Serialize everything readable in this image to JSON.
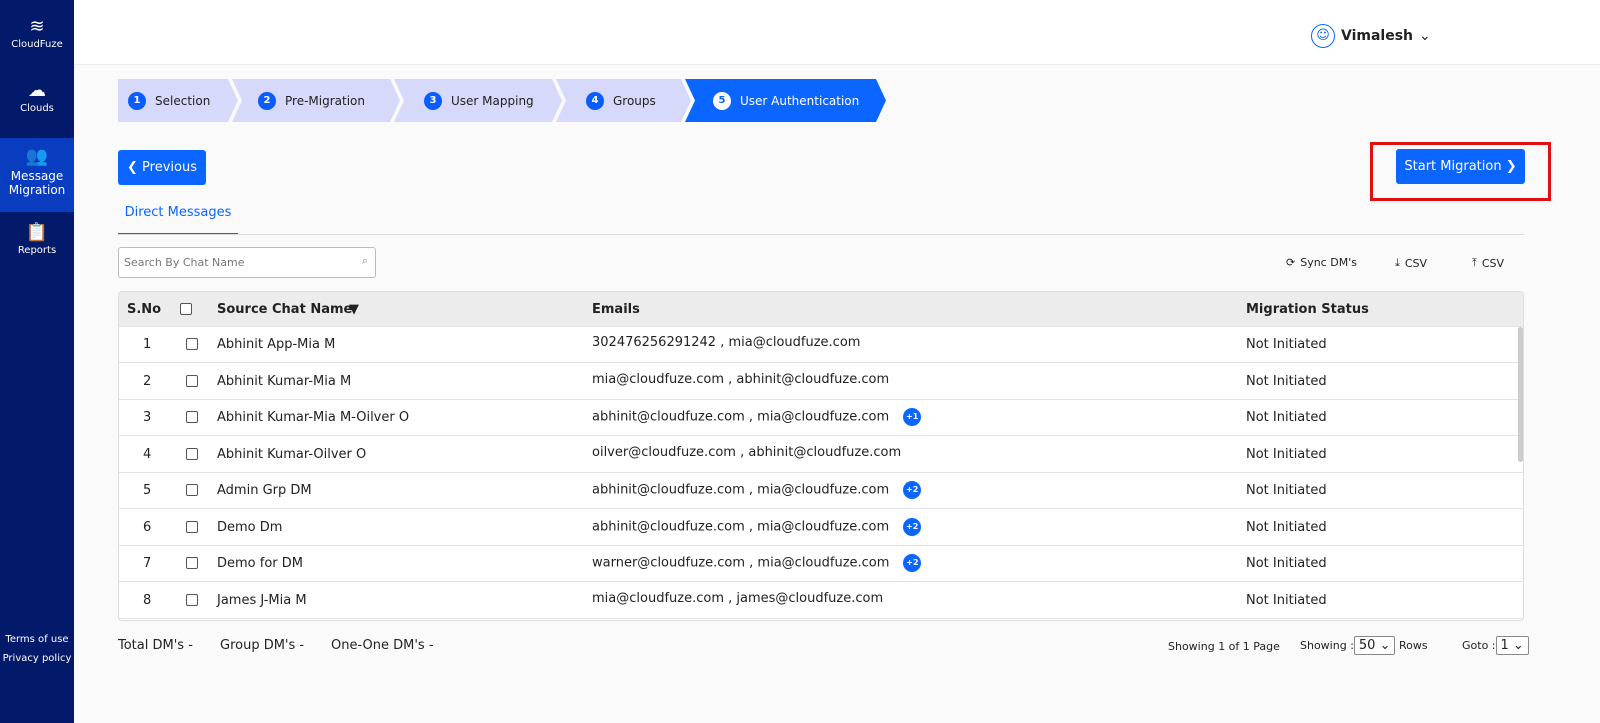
{
  "sidebar": {
    "brand": "CloudFuze",
    "items": [
      {
        "label": "Clouds",
        "icon": "cloud-icon"
      },
      {
        "label": "Message Migration",
        "icon": "users-icon",
        "active": true
      },
      {
        "label": "Reports",
        "icon": "clipboard-icon"
      }
    ],
    "footer": [
      "Terms of use",
      "Privacy policy"
    ]
  },
  "header": {
    "user": "Vimalesh"
  },
  "steps": [
    {
      "n": "1",
      "label": "Selection"
    },
    {
      "n": "2",
      "label": "Pre-Migration"
    },
    {
      "n": "3",
      "label": "User Mapping"
    },
    {
      "n": "4",
      "label": "Groups"
    },
    {
      "n": "5",
      "label": "User Authentication",
      "active": true
    }
  ],
  "buttons": {
    "previous": "Previous",
    "start": "Start Migration"
  },
  "tab": "Direct Messages",
  "search": {
    "placeholder": "Search By Chat Name"
  },
  "tools": {
    "sync": "Sync DM's",
    "download": "CSV",
    "upload": "CSV"
  },
  "table": {
    "headers": [
      "S.No",
      "Source Chat Name",
      "Emails",
      "Migration Status"
    ],
    "rows": [
      {
        "sno": "1",
        "name": "Abhinit App-Mia M",
        "emails": "302476256291242 , mia@cloudfuze.com",
        "extra": "",
        "status": "Not Initiated"
      },
      {
        "sno": "2",
        "name": "Abhinit Kumar-Mia M",
        "emails": "mia@cloudfuze.com , abhinit@cloudfuze.com",
        "extra": "",
        "status": "Not Initiated"
      },
      {
        "sno": "3",
        "name": "Abhinit Kumar-Mia M-Oilver O",
        "emails": "abhinit@cloudfuze.com , mia@cloudfuze.com",
        "extra": "+1",
        "status": "Not Initiated"
      },
      {
        "sno": "4",
        "name": "Abhinit Kumar-Oilver O",
        "emails": "oilver@cloudfuze.com , abhinit@cloudfuze.com",
        "extra": "",
        "status": "Not Initiated"
      },
      {
        "sno": "5",
        "name": "Admin Grp DM",
        "emails": "abhinit@cloudfuze.com , mia@cloudfuze.com",
        "extra": "+2",
        "status": "Not Initiated"
      },
      {
        "sno": "6",
        "name": "Demo Dm",
        "emails": "abhinit@cloudfuze.com , mia@cloudfuze.com",
        "extra": "+2",
        "status": "Not Initiated"
      },
      {
        "sno": "7",
        "name": "Demo for DM",
        "emails": "warner@cloudfuze.com , mia@cloudfuze.com",
        "extra": "+2",
        "status": "Not Initiated"
      },
      {
        "sno": "8",
        "name": "James J-Mia M",
        "emails": "mia@cloudfuze.com , james@cloudfuze.com",
        "extra": "",
        "status": "Not Initiated"
      }
    ]
  },
  "footer": {
    "total": "Total DM's -",
    "group": "Group DM's -",
    "one": "One-One DM's -",
    "pages": "Showing 1 of 1 Page",
    "showing": "Showing :",
    "rows_value": "50",
    "rows": "Rows",
    "goto": "Goto :",
    "goto_value": "1"
  },
  "colors": {
    "sidebar": "#031a6b",
    "accent": "#0a66ff",
    "highlight": "#e01010"
  }
}
